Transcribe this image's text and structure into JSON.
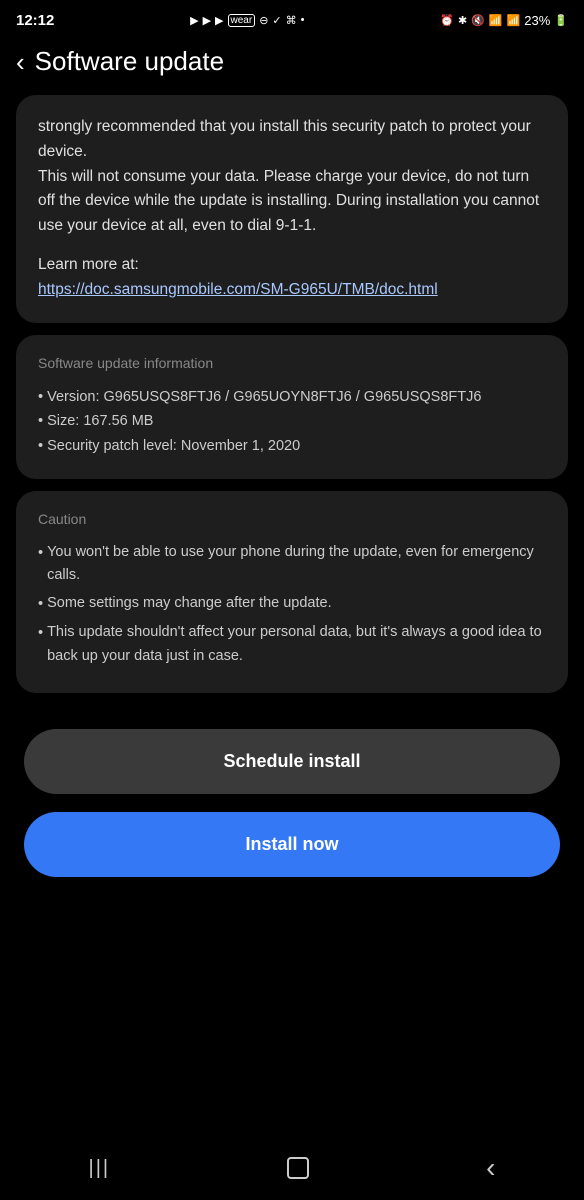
{
  "statusBar": {
    "time": "12:12",
    "batteryPercent": "23%",
    "icons": [
      "▶",
      "▶",
      "▶",
      "⊖",
      "✓",
      "⌘",
      "•"
    ]
  },
  "header": {
    "backLabel": "‹",
    "title": "Software update"
  },
  "descriptionCard": {
    "text1": "strongly recommended that you install this security patch to protect your device.",
    "text2": " This will not consume your data.  Please charge your device,  do not turn off the device while the update is installing. During installation you cannot use your device at all, even to dial 9-1-1.",
    "learnMoreLabel": "Learn more at:",
    "link": "https://doc.samsungmobile.com/SM-G965U/TMB/doc.html"
  },
  "infoCard": {
    "title": "Software update information",
    "items": [
      {
        "bullet": "•",
        "text": "Version: G965USQS8FTJ6 / G965UOYN8FTJ6 / G965USQS8FTJ6"
      },
      {
        "bullet": "•",
        "text": "Size: 167.56 MB"
      },
      {
        "bullet": "•",
        "text": "Security patch level: November 1, 2020"
      }
    ]
  },
  "cautionCard": {
    "title": "Caution",
    "items": [
      {
        "bullet": "•",
        "text": "You won't be able to use your phone during the update, even for emergency calls."
      },
      {
        "bullet": "•",
        "text": "Some settings may change after the update."
      },
      {
        "bullet": "•",
        "text": "This update shouldn't affect your personal data, but it's always a good idea to back up your data just in case."
      }
    ]
  },
  "buttons": {
    "schedule": "Schedule install",
    "install": "Install now"
  },
  "bottomNav": {
    "recent": "|||",
    "home": "○",
    "back": "‹"
  }
}
